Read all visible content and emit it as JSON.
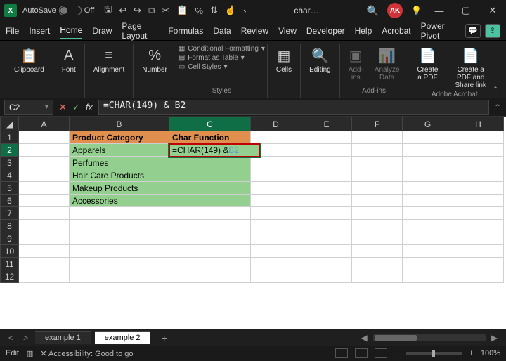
{
  "titlebar": {
    "autosave_label": "AutoSave",
    "autosave_state": "Off",
    "filename": "char…",
    "user_initials": "AK"
  },
  "tabs": [
    "File",
    "Insert",
    "Home",
    "Draw",
    "Page Layout",
    "Formulas",
    "Data",
    "Review",
    "View",
    "Developer",
    "Help",
    "Acrobat",
    "Power Pivot"
  ],
  "active_tab": "Home",
  "ribbon": {
    "clipboard": "Clipboard",
    "font": "Font",
    "alignment": "Alignment",
    "number": "Number",
    "styles_label": "Styles",
    "cond_fmt": "Conditional Formatting",
    "fmt_table": "Format as Table",
    "cell_styles": "Cell Styles",
    "cells": "Cells",
    "editing": "Editing",
    "addins": "Add-ins",
    "addins_label": "Add-ins",
    "analyze": "Analyze Data",
    "create_pdf": "Create a PDF",
    "share_pdf": "Create a PDF and Share link",
    "adobe_label": "Adobe Acrobat"
  },
  "namebox": "C2",
  "formula": "=CHAR(149)  &  B2",
  "cell_formula_prefix": "=CHAR(149) & ",
  "cell_formula_ref": "B2",
  "columns": [
    "A",
    "B",
    "C",
    "D",
    "E",
    "F",
    "G",
    "H"
  ],
  "rows": [
    "1",
    "2",
    "3",
    "4",
    "5",
    "6",
    "7",
    "8",
    "9",
    "10",
    "11",
    "12"
  ],
  "headers": {
    "b1": "Product Category",
    "c1": "Char Function"
  },
  "data": {
    "b2": "Apparels",
    "b3": "Perfumes",
    "b4": "Hair Care Products",
    "b5": "Makeup Products",
    "b6": "Accessories"
  },
  "sheets": {
    "s1": "example 1",
    "s2": "example 2"
  },
  "status": {
    "mode": "Edit",
    "accessibility": "Accessibility: Good to go",
    "zoom": "100%"
  }
}
